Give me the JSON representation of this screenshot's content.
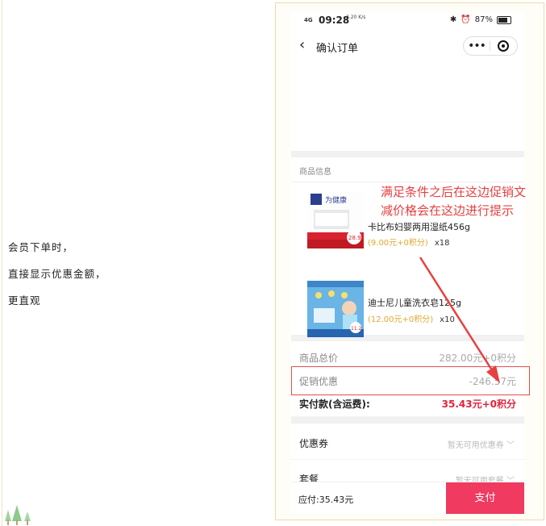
{
  "note": {
    "line1": "会员下单时，",
    "line2": "直接显示优惠金额，",
    "line3": "更直观"
  },
  "status_bar": {
    "signal": "4G",
    "time": "09:28",
    "speed": "3.20 K/s",
    "battery": "87%"
  },
  "nav": {
    "back_icon": "chevron-left-icon",
    "title": "确认订单",
    "more_icon": "more-dots-icon",
    "close_icon": "target-icon"
  },
  "goods": {
    "section_title": "商品信息",
    "items": [
      {
        "name": "卡比布妇婴两用湿纸456g",
        "price": "(9.00元+0积分)",
        "qty": "x18",
        "thumb_text": "为健康",
        "thumb_badge": "28.9"
      },
      {
        "name": "迪士尼儿童洗衣皂125g",
        "price": "(12.00元+0积分)",
        "qty": "x10",
        "thumb_badge": "11.2"
      }
    ]
  },
  "summary": {
    "total_label": "商品总价",
    "total_value": "282.00元+0积分",
    "promo_label": "促销优惠",
    "promo_value": "-246.57元",
    "pay_label": "实付款(含运费):",
    "pay_value": "35.43元+0积分"
  },
  "options": {
    "coupon_label": "优惠券",
    "coupon_value": "暂无可用优惠券",
    "package_label": "套餐",
    "package_value": "暂无可用套餐"
  },
  "bottom": {
    "due": "应付:35.43元",
    "pay_button": "支付"
  },
  "annotation": {
    "text": "满足条件之后在这边促销文减价格会在这边进行提示"
  },
  "colors": {
    "accent": "#f03a5f",
    "promo_red": "#e0233d",
    "annotation_red": "#e84040"
  }
}
